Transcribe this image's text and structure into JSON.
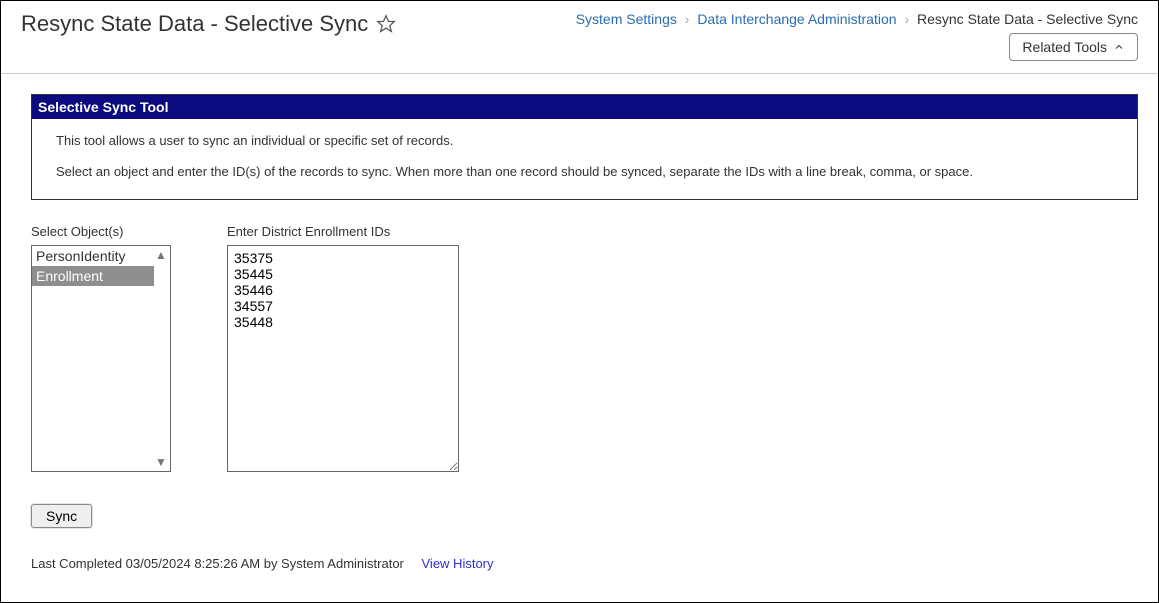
{
  "header": {
    "title": "Resync State Data - Selective Sync",
    "breadcrumb": {
      "system_settings": "System Settings",
      "data_interchange": "Data Interchange Administration",
      "current": "Resync State Data - Selective Sync"
    },
    "related_tools_label": "Related Tools"
  },
  "panel": {
    "title": "Selective Sync Tool",
    "desc1": "This tool allows a user to sync an individual or specific set of records.",
    "desc2": "Select an object and enter the ID(s) of the records to sync. When more than one record should be synced, separate the IDs with a line break, comma, or space."
  },
  "form": {
    "select_objects_label": "Select Object(s)",
    "objects": [
      {
        "label": "PersonIdentity",
        "selected": false
      },
      {
        "label": "Enrollment",
        "selected": true
      }
    ],
    "ids_label": "Enter District Enrollment IDs",
    "ids_value": "35375\n35445\n35446\n34557\n35448",
    "sync_button_label": "Sync"
  },
  "status": {
    "text": "Last Completed 03/05/2024 8:25:26 AM by System Administrator",
    "view_history_label": "View History"
  }
}
